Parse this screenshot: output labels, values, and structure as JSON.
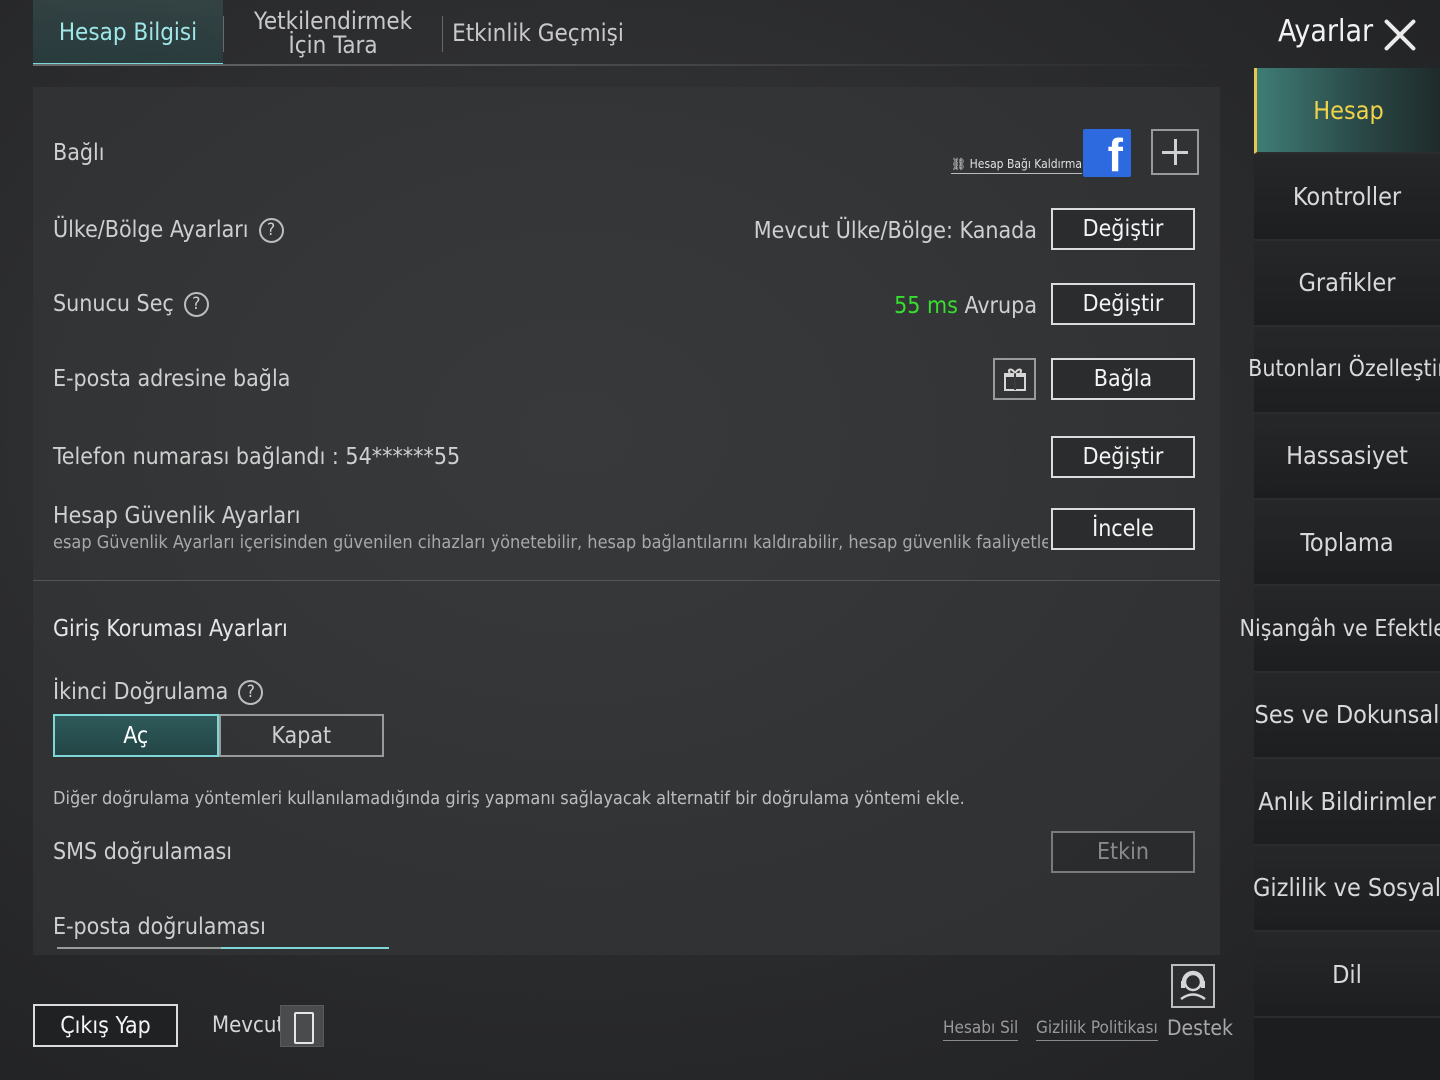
{
  "top_tabs": [
    {
      "label": "Hesap Bilgisi",
      "active": true
    },
    {
      "label": "Yetkilendirmek İçin Tara",
      "active": false
    },
    {
      "label": "Etkinlik Geçmişi",
      "active": false
    }
  ],
  "header": {
    "title": "Ayarlar"
  },
  "sidebar": {
    "items": [
      {
        "label": "Hesap",
        "active": true
      },
      {
        "label": "Kontroller"
      },
      {
        "label": "Grafikler"
      },
      {
        "label": "Butonları Özelleştir"
      },
      {
        "label": "Hassasiyet"
      },
      {
        "label": "Toplama"
      },
      {
        "label": "Nişangâh ve Efektler"
      },
      {
        "label": "Ses ve Dokunsal"
      },
      {
        "label": "Anlık Bildirimler"
      },
      {
        "label": "Gizlilik ve Sosyal"
      },
      {
        "label": "Dil"
      }
    ]
  },
  "account": {
    "linked_label": "Bağlı",
    "unlink_label": "Hesap Bağı Kaldırma",
    "region_label": "Ülke/Bölge Ayarları",
    "region_value": "Mevcut Ülke/Bölge: Kanada",
    "region_button": "Değiştir",
    "server_label": "Sunucu Seç",
    "server_ping": "55 ms",
    "server_name": "Avrupa",
    "server_button": "Değiştir",
    "email_label": "E-posta adresine bağla",
    "email_button": "Bağla",
    "phone_label": "Telefon numarası bağlandı : 54******55",
    "phone_button": "Değiştir",
    "security_label": "Hesap Güvenlik Ayarları",
    "security_desc": "esap Güvenlik Ayarları içerisinden güvenilen cihazları yönetebilir, hesap bağlantılarını kaldırabilir, hesap güvenlik faaliyetlerini kontrol edebilir",
    "security_button": "İncele"
  },
  "login_protection": {
    "title": "Giriş Koruması Ayarları",
    "second_auth_label": "İkinci Doğrulama",
    "toggle_on": "Aç",
    "toggle_off": "Kapat",
    "description": "Diğer doğrulama yöntemleri kullanılamadığında giriş yapmanı sağlayacak alternatif bir doğrulama yöntemi ekle.",
    "sms_label": "SMS doğrulaması",
    "sms_button": "Etkin",
    "email_verify_label": "E-posta doğrulaması"
  },
  "footer": {
    "logout_button": "Çıkış Yap",
    "device_label": "Mevcut",
    "delete_account": "Hesabı Sil",
    "privacy_policy": "Gizlilik Politikası",
    "support_label": "Destek"
  },
  "colors": {
    "accent": "#7fd6d6",
    "active_sidebar_text": "#f2d24a",
    "ping_green": "#37e02f",
    "facebook_blue": "#2d6ae0"
  }
}
